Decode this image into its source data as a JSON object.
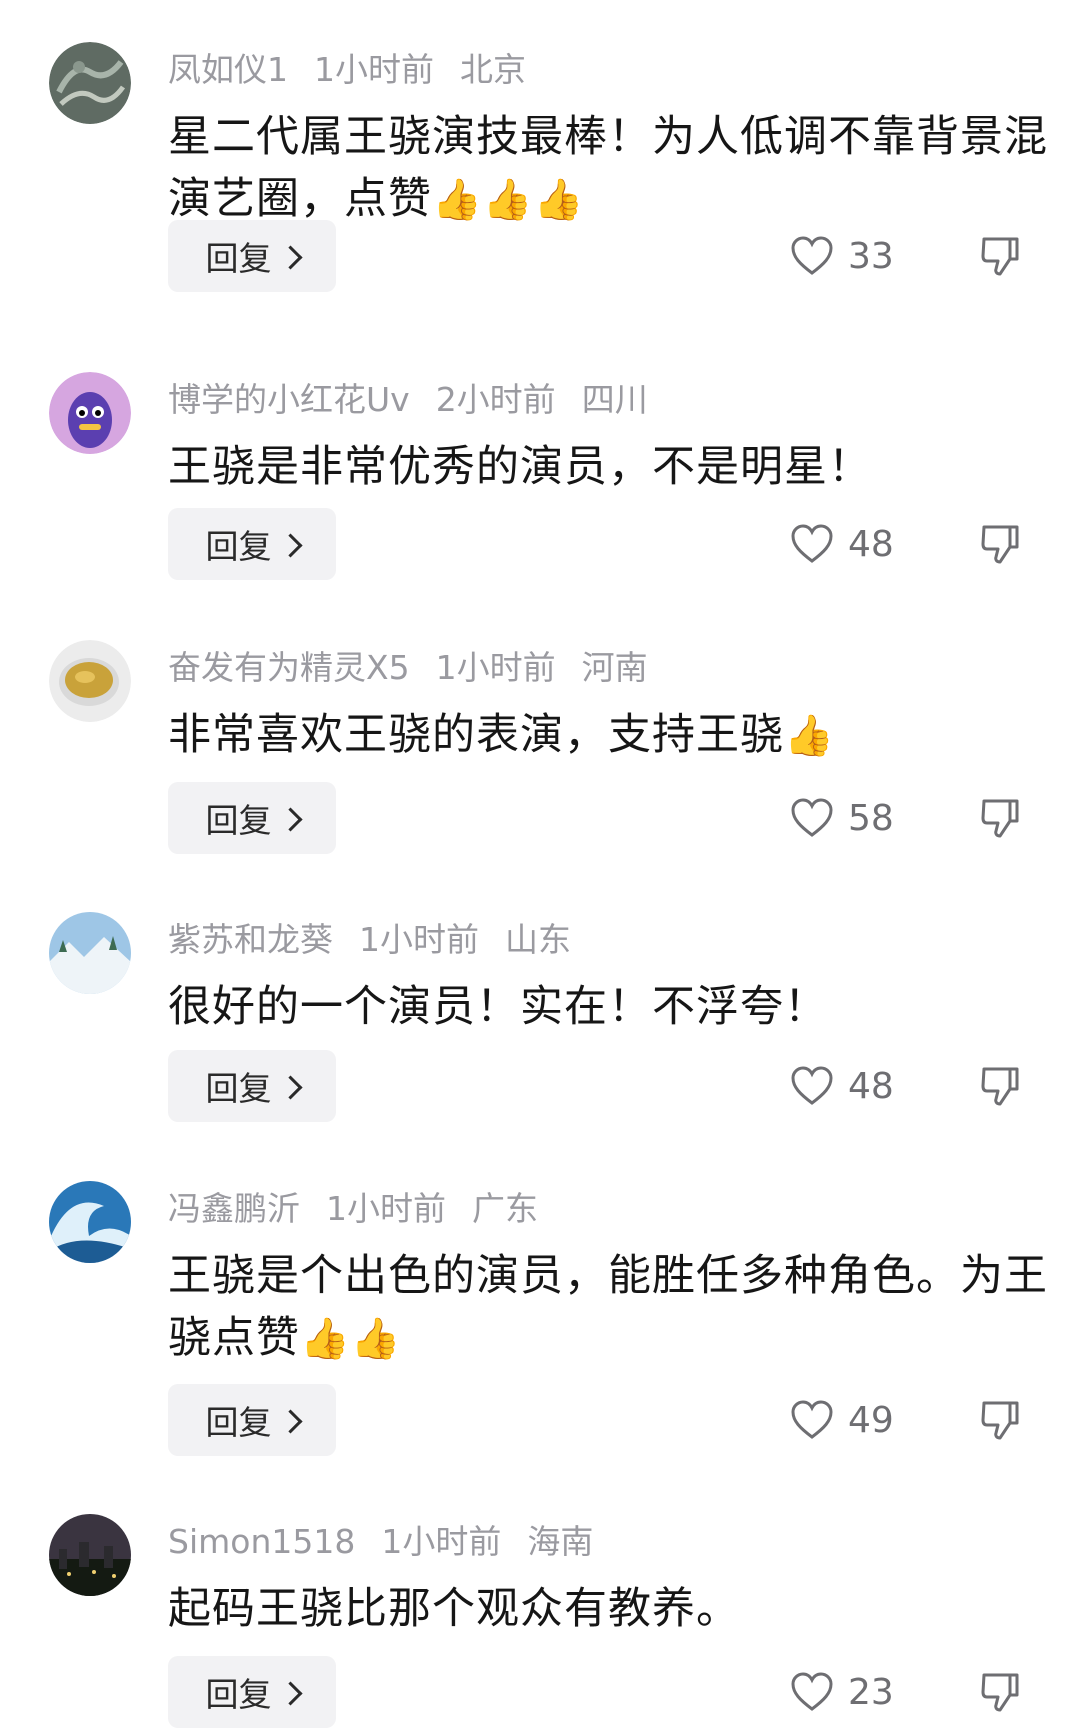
{
  "reply_label": "回复",
  "comments": [
    {
      "username": "凤如仪1",
      "time": "1小时前",
      "location": "北京",
      "text": "星二代属王骁演技最棒！为人低调不靠背景混演艺圈，点赞",
      "emoji": "👍👍👍",
      "likes": "33",
      "avatar_icon": "avatar-dragon-relief"
    },
    {
      "username": "博学的小红花Uv",
      "time": "2小时前",
      "location": "四川",
      "text": "王骁是非常优秀的演员，不是明星！",
      "emoji": "",
      "likes": "48",
      "avatar_icon": "avatar-purple-cartoon"
    },
    {
      "username": "奋发有为精灵X5",
      "time": "1小时前",
      "location": "河南",
      "text": "非常喜欢王骁的表演，支持王骁",
      "emoji": "👍",
      "likes": "58",
      "avatar_icon": "avatar-tea-cup"
    },
    {
      "username": "紫苏和龙葵",
      "time": "1小时前",
      "location": "山东",
      "text": "很好的一个演员！实在！不浮夸！",
      "emoji": "",
      "likes": "48",
      "avatar_icon": "avatar-snow-landscape"
    },
    {
      "username": "冯鑫鹏沂",
      "time": "1小时前",
      "location": "广东",
      "text": "王骁是个出色的演员，能胜任多种角色。为王骁点赞",
      "emoji": "👍👍",
      "likes": "49",
      "avatar_icon": "avatar-ocean-wave"
    },
    {
      "username": "Simon1518",
      "time": "1小时前",
      "location": "海南",
      "text": "起码王骁比那个观众有教养。",
      "emoji": "",
      "likes": "23",
      "avatar_icon": "avatar-night-city"
    }
  ]
}
